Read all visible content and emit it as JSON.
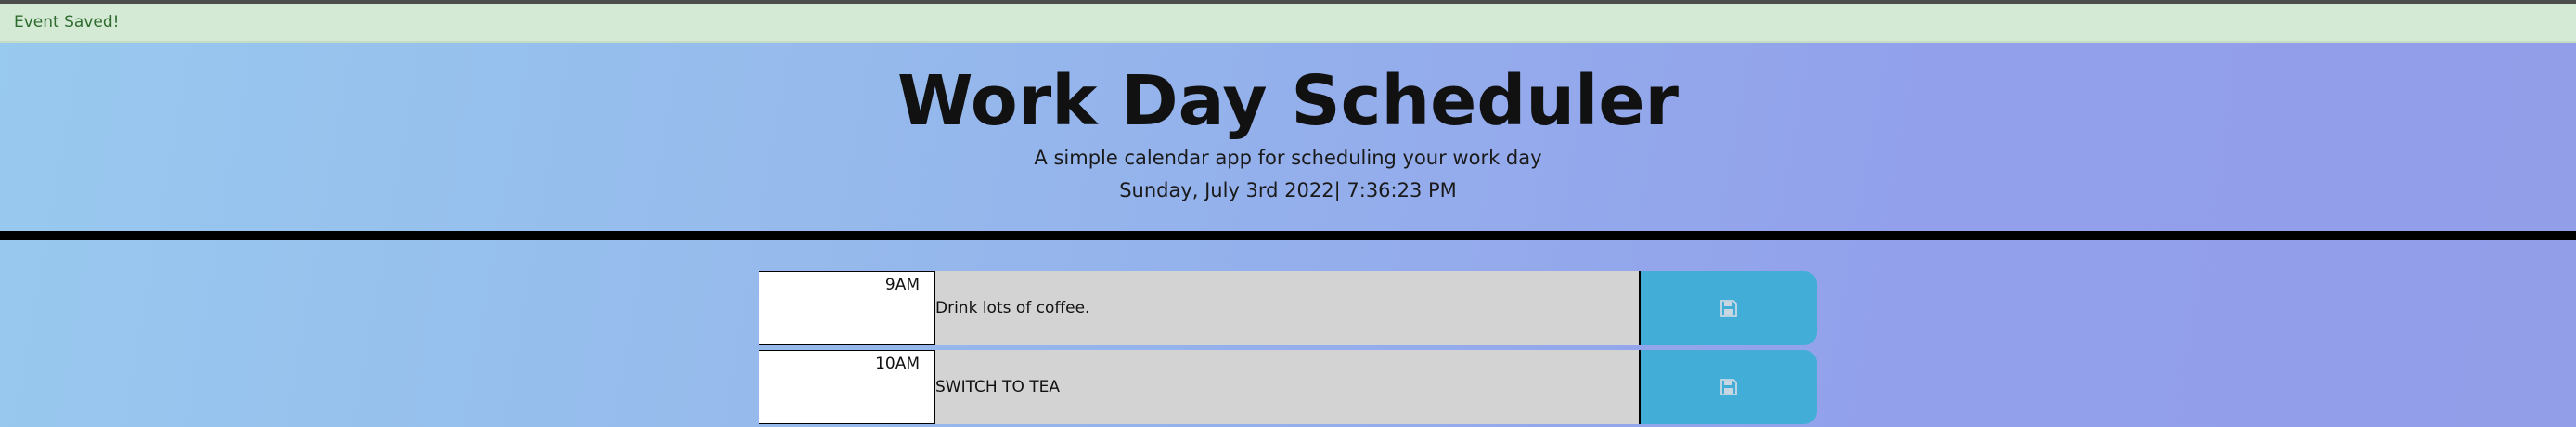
{
  "alert": {
    "text": "Event Saved!"
  },
  "header": {
    "title": "Work Day Scheduler",
    "subtitle": "A simple calendar app for scheduling your work day",
    "datetime": "Sunday, July 3rd 2022| 7:36:23 PM"
  },
  "colors": {
    "alert_bg": "#d5ead5",
    "description_bg": "#d3d3d3",
    "save_button": "#42aed8"
  },
  "timeblocks": [
    {
      "hour": "9AM",
      "description": "Drink lots of coffee.",
      "save_icon": "floppy-disk-icon"
    },
    {
      "hour": "10AM",
      "description": "SWITCH TO TEA",
      "save_icon": "floppy-disk-icon"
    }
  ]
}
